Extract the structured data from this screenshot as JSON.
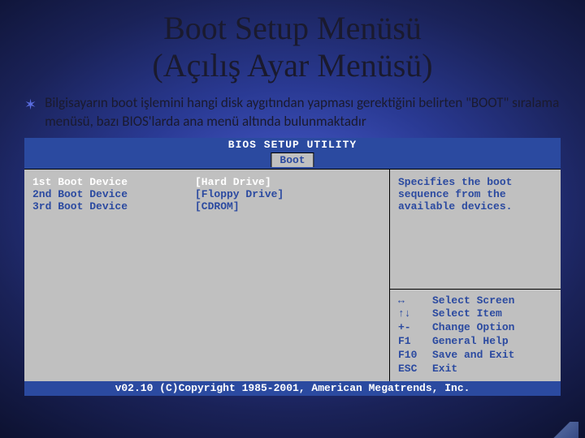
{
  "slide": {
    "title_line1": "Boot Setup Menüsü",
    "title_line2": "(Açılış Ayar Menüsü)",
    "bullet_text": "Bilgisayarın boot işlemini hangi disk aygıtından yapması gerektiğini belirten \"BOOT\" sıralama menüsü, bazı BIOS'larda ana menü altında bulunmaktadır"
  },
  "bios": {
    "header": "BIOS SETUP UTILITY",
    "active_tab": "Boot",
    "boot_items": [
      {
        "label": "1st Boot Device",
        "value": "[Hard Drive]",
        "selected": true
      },
      {
        "label": "2nd Boot Device",
        "value": "[Floppy Drive]",
        "selected": false
      },
      {
        "label": "3rd Boot Device",
        "value": "[CDROM]",
        "selected": false
      }
    ],
    "help_text": "Specifies the boot sequence from the available devices.",
    "hints": [
      {
        "key": "↔",
        "desc": "Select Screen"
      },
      {
        "key": "↑↓",
        "desc": "Select Item"
      },
      {
        "key": "+-",
        "desc": "Change Option"
      },
      {
        "key": "F1",
        "desc": "General Help"
      },
      {
        "key": "F10",
        "desc": "Save and Exit"
      },
      {
        "key": "ESC",
        "desc": "Exit"
      }
    ],
    "footer": "v02.10 (C)Copyright 1985-2001, American Megatrends, Inc."
  }
}
